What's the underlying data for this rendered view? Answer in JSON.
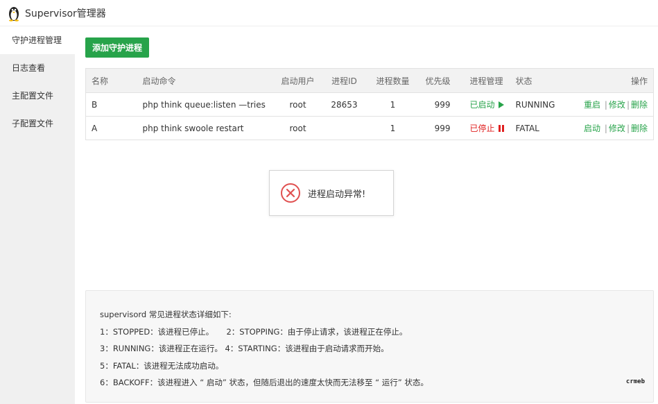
{
  "app": {
    "title": "Supervisor管理器"
  },
  "sidebar": {
    "items": [
      {
        "label": "守护进程管理"
      },
      {
        "label": "日志查看"
      },
      {
        "label": "主配置文件"
      },
      {
        "label": "子配置文件"
      }
    ]
  },
  "toolbar": {
    "add_label": "添加守护进程"
  },
  "table": {
    "headers": {
      "name": "名称",
      "command": "启动命令",
      "user": "启动用户",
      "pid": "进程ID",
      "count": "进程数量",
      "priority": "优先级",
      "manage": "进程管理",
      "status": "状态",
      "ops": "操作"
    },
    "rows": [
      {
        "name": "B",
        "command": "php think queue:listen —tries",
        "user": "root",
        "pid": "28653",
        "count": "1",
        "priority": "999",
        "manage": "已启动",
        "status": "RUNNING",
        "op1": "重启",
        "op2": "修改",
        "op3": "删除",
        "sep": "|"
      },
      {
        "name": "A",
        "command": "php think swoole restart",
        "user": "root",
        "pid": "",
        "count": "1",
        "priority": "999",
        "manage": "已停止",
        "status": "FATAL",
        "op1": "启动",
        "op2": "修改",
        "op3": "删除",
        "sep": "|"
      }
    ]
  },
  "toast": {
    "message": "进程启动异常!"
  },
  "info": {
    "lines": [
      "supervisord 常见进程状态详细如下:",
      "1：STOPPED：该进程已停止。     2：STOPPING：由于停止请求，该进程正在停止。",
      "3：RUNNING：该进程正在运行。 4：STARTING：该进程由于启动请求而开始。",
      "5：FATAL：该进程无法成功启动。",
      "6：BACKOFF：该进程进入 “ 启动” 状态，但随后退出的速度太快而无法移至 “ 运行” 状态。"
    ],
    "watermark": "crmeb"
  },
  "colors": {
    "accent": "#27a34a",
    "error": "#e02020"
  }
}
